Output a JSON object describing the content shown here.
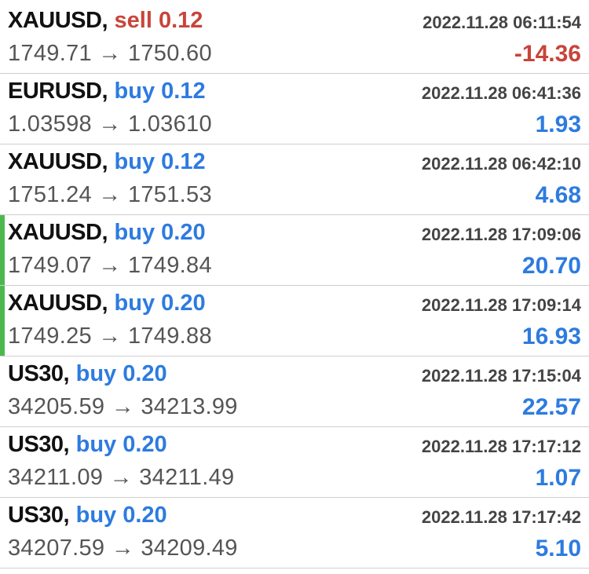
{
  "colors": {
    "buy": "#2d7be0",
    "sell": "#c8443a",
    "profit_positive": "#2d7be0",
    "profit_negative": "#c8443a",
    "marker": "#4cb84c"
  },
  "trades": [
    {
      "symbol": "XAUUSD",
      "side": "sell",
      "side_label": "sell 0.12",
      "time": "2022.11.28 06:11:54",
      "prices": "1749.71 → 1750.60",
      "profit": "-14.36",
      "marked": false
    },
    {
      "symbol": "EURUSD",
      "side": "buy",
      "side_label": "buy 0.12",
      "time": "2022.11.28 06:41:36",
      "prices": "1.03598 → 1.03610",
      "profit": "1.93",
      "marked": false
    },
    {
      "symbol": "XAUUSD",
      "side": "buy",
      "side_label": "buy 0.12",
      "time": "2022.11.28 06:42:10",
      "prices": "1751.24 → 1751.53",
      "profit": "4.68",
      "marked": false
    },
    {
      "symbol": "XAUUSD",
      "side": "buy",
      "side_label": "buy 0.20",
      "time": "2022.11.28 17:09:06",
      "prices": "1749.07 → 1749.84",
      "profit": "20.70",
      "marked": true
    },
    {
      "symbol": "XAUUSD",
      "side": "buy",
      "side_label": "buy 0.20",
      "time": "2022.11.28 17:09:14",
      "prices": "1749.25 → 1749.88",
      "profit": "16.93",
      "marked": true
    },
    {
      "symbol": "US30",
      "side": "buy",
      "side_label": "buy 0.20",
      "time": "2022.11.28 17:15:04",
      "prices": "34205.59 → 34213.99",
      "profit": "22.57",
      "marked": false
    },
    {
      "symbol": "US30",
      "side": "buy",
      "side_label": "buy 0.20",
      "time": "2022.11.28 17:17:12",
      "prices": "34211.09 → 34211.49",
      "profit": "1.07",
      "marked": false
    },
    {
      "symbol": "US30",
      "side": "buy",
      "side_label": "buy 0.20",
      "time": "2022.11.28 17:17:42",
      "prices": "34207.59 → 34209.49",
      "profit": "5.10",
      "marked": false
    }
  ]
}
